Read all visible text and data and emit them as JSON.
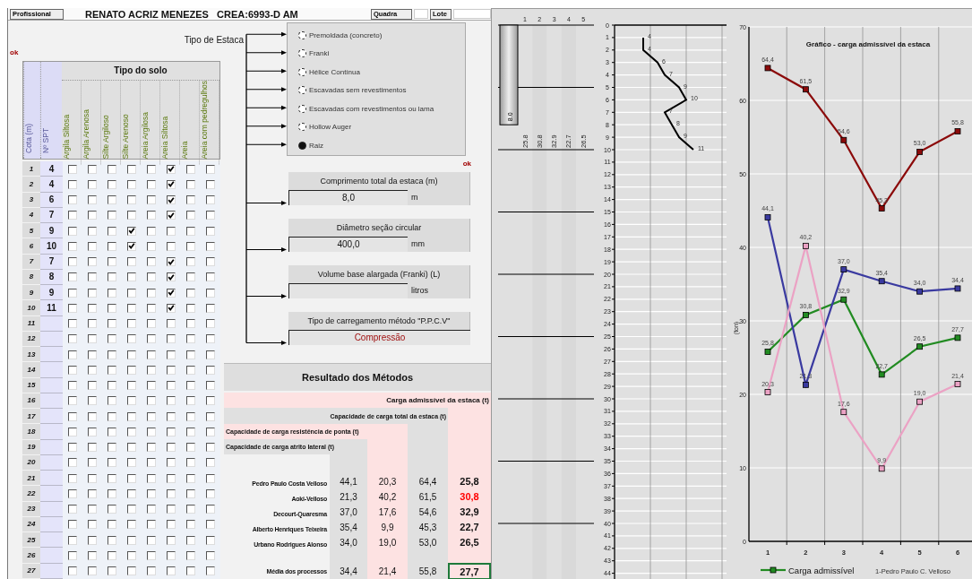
{
  "header": {
    "profissional_button": "Profissional",
    "title": "RENATO ACRIZ MENEZES   CREA:6993-D AM",
    "quadra_button": "Quadra",
    "lote_button": "Lote"
  },
  "soil_table": {
    "status": "ok",
    "cota_header": "Cota (m)",
    "spt_header": "Nº SPT",
    "group_header": "Tipo do solo",
    "soils": [
      "Argila Siltosa",
      "Argila Arenosa",
      "Silte Argiloso",
      "Silte Arenoso",
      "Areia Argilosa",
      "Areia Siltosa",
      "Areia",
      "Areia com pedregulhos"
    ],
    "rows": [
      {
        "cota": "1",
        "spt": "4",
        "soil": [
          false,
          false,
          false,
          false,
          false,
          true,
          false,
          false
        ]
      },
      {
        "cota": "2",
        "spt": "4",
        "soil": [
          false,
          false,
          false,
          false,
          false,
          true,
          false,
          false
        ]
      },
      {
        "cota": "3",
        "spt": "6",
        "soil": [
          false,
          false,
          false,
          false,
          false,
          true,
          false,
          false
        ]
      },
      {
        "cota": "4",
        "spt": "7",
        "soil": [
          false,
          false,
          false,
          false,
          false,
          true,
          false,
          false
        ]
      },
      {
        "cota": "5",
        "spt": "9",
        "soil": [
          false,
          false,
          false,
          true,
          false,
          false,
          false,
          false
        ]
      },
      {
        "cota": "6",
        "spt": "10",
        "soil": [
          false,
          false,
          false,
          true,
          false,
          false,
          false,
          false
        ]
      },
      {
        "cota": "7",
        "spt": "7",
        "soil": [
          false,
          false,
          false,
          false,
          false,
          true,
          false,
          false
        ]
      },
      {
        "cota": "8",
        "spt": "8",
        "soil": [
          false,
          false,
          false,
          false,
          false,
          true,
          false,
          false
        ]
      },
      {
        "cota": "9",
        "spt": "9",
        "soil": [
          false,
          false,
          false,
          false,
          false,
          true,
          false,
          false
        ]
      },
      {
        "cota": "10",
        "spt": "11",
        "soil": [
          false,
          false,
          false,
          false,
          false,
          true,
          false,
          false
        ]
      },
      {
        "cota": "11",
        "soil": [
          false,
          false,
          false,
          false,
          false,
          false,
          false,
          false
        ]
      },
      {
        "cota": "12",
        "soil": [
          false,
          false,
          false,
          false,
          false,
          false,
          false,
          false
        ]
      },
      {
        "cota": "13",
        "soil": [
          false,
          false,
          false,
          false,
          false,
          false,
          false,
          false
        ]
      },
      {
        "cota": "14",
        "soil": [
          false,
          false,
          false,
          false,
          false,
          false,
          false,
          false
        ]
      },
      {
        "cota": "15",
        "soil": [
          false,
          false,
          false,
          false,
          false,
          false,
          false,
          false
        ]
      },
      {
        "cota": "16",
        "soil": [
          false,
          false,
          false,
          false,
          false,
          false,
          false,
          false
        ]
      },
      {
        "cota": "17",
        "soil": [
          false,
          false,
          false,
          false,
          false,
          false,
          false,
          false
        ]
      },
      {
        "cota": "18",
        "soil": [
          false,
          false,
          false,
          false,
          false,
          false,
          false,
          false
        ]
      },
      {
        "cota": "19",
        "soil": [
          false,
          false,
          false,
          false,
          false,
          false,
          false,
          false
        ]
      },
      {
        "cota": "20",
        "soil": [
          false,
          false,
          false,
          false,
          false,
          false,
          false,
          false
        ]
      },
      {
        "cota": "21",
        "soil": [
          false,
          false,
          false,
          false,
          false,
          false,
          false,
          false
        ]
      },
      {
        "cota": "22",
        "soil": [
          false,
          false,
          false,
          false,
          false,
          false,
          false,
          false
        ]
      },
      {
        "cota": "23",
        "soil": [
          false,
          false,
          false,
          false,
          false,
          false,
          false,
          false
        ]
      },
      {
        "cota": "24",
        "soil": [
          false,
          false,
          false,
          false,
          false,
          false,
          false,
          false
        ]
      },
      {
        "cota": "25",
        "soil": [
          false,
          false,
          false,
          false,
          false,
          false,
          false,
          false
        ]
      },
      {
        "cota": "26",
        "soil": [
          false,
          false,
          false,
          false,
          false,
          false,
          false,
          false
        ]
      },
      {
        "cota": "27",
        "soil": [
          false,
          false,
          false,
          false,
          false,
          false,
          false,
          false
        ]
      }
    ]
  },
  "pile_type": {
    "label": "Tipo de Estaca",
    "options": [
      {
        "label": "Premoldada (concreto)",
        "selected": false
      },
      {
        "label": "Franki",
        "selected": false
      },
      {
        "label": "Hélice Contínua",
        "selected": false
      },
      {
        "label": "Escavadas sem revestimentos",
        "selected": false
      },
      {
        "label": "Escavadas com revestimentos ou lama",
        "selected": false
      },
      {
        "label": "Hollow Auger",
        "selected": false
      },
      {
        "label": "Raiz",
        "selected": true
      }
    ]
  },
  "parameters": {
    "status": "ok",
    "inputs": [
      {
        "kind": "measure",
        "title": "Comprimento total da estaca (m)",
        "value": "8,0",
        "unit": "m"
      },
      {
        "kind": "measure",
        "title": "Diâmetro seção circular",
        "value": "400,0",
        "unit": "mm"
      },
      {
        "kind": "measure",
        "title": "Volume base alargada (Franki) (L)",
        "unit": "litros"
      },
      {
        "kind": "choice",
        "title": "Tipo de carregamento método \"P.P.C.V\"",
        "value": "Compressão"
      }
    ]
  },
  "results": {
    "title": "Resultado dos Métodos",
    "headers": [
      "Carga admissível da estaca (t)",
      "Capacidade de carga total da estaca (t)",
      "Capacidade de carga resistência de ponta (t)",
      "Capacidade de carga atrito lateral (t)"
    ],
    "methods": [
      {
        "name": "Pedro Paulo Costa Velloso",
        "lateral": "44,1",
        "ponta": "20,3",
        "total": "64,4",
        "admissible": "25,8",
        "flagged": false
      },
      {
        "name": "Aoki-Velloso",
        "lateral": "21,3",
        "ponta": "40,2",
        "total": "61,5",
        "admissible": "30,8",
        "flagged": true
      },
      {
        "name": "Decourt-Quaresma",
        "lateral": "37,0",
        "ponta": "17,6",
        "total": "54,6",
        "admissible": "32,9",
        "flagged": false
      },
      {
        "name": "Alberto Henriques Teixeira",
        "lateral": "35,4",
        "ponta": "9,9",
        "total": "45,3",
        "admissible": "22,7",
        "flagged": false
      },
      {
        "name": "Urbano Rodrigues Alonso",
        "lateral": "34,0",
        "ponta": "19,0",
        "total": "53,0",
        "admissible": "26,5",
        "flagged": false
      }
    ],
    "average": {
      "name": "Média dos processos",
      "lateral": "34,4",
      "ponta": "21,4",
      "total": "55,8",
      "admissible": "27,7",
      "selected": true
    }
  },
  "pile_diagram": {
    "length": "8.0",
    "columns": [
      {
        "label": "1",
        "value": "25.8"
      },
      {
        "label": "2",
        "value": "30.8"
      },
      {
        "label": "3",
        "value": "32.9"
      },
      {
        "label": "4",
        "value": "22.7"
      },
      {
        "label": "5",
        "value": "26.5"
      }
    ]
  },
  "spt_profile": {
    "depth_labels": [
      "0",
      "1",
      "2",
      "3",
      "4",
      "5",
      "6",
      "7",
      "8",
      "9",
      "10",
      "11",
      "12",
      "13",
      "14",
      "15",
      "16",
      "17",
      "18",
      "19",
      "20",
      "21",
      "22",
      "23",
      "24",
      "25",
      "26",
      "27",
      "28",
      "29",
      "30",
      "31",
      "32",
      "33",
      "34",
      "35",
      "36",
      "37",
      "38",
      "39",
      "40",
      "41",
      "42",
      "43",
      "44"
    ],
    "point_labels": [
      "4",
      "4",
      "6",
      "7",
      "9",
      "10",
      "7",
      "8",
      "9",
      "11"
    ]
  },
  "load_chart": {
    "legend_note": "1-Pedro Paulo C. Velloso",
    "chart_data": {
      "type": "line",
      "title": "Gráfico - carga admissível da estaca",
      "ylabel": "(ton)",
      "categories": [
        "1",
        "2",
        "3",
        "4",
        "5",
        "6"
      ],
      "ylim": [
        0,
        70
      ],
      "yticks": [
        0,
        10,
        20,
        30,
        40,
        50,
        60,
        70
      ],
      "grid": true,
      "series": [
        {
          "name": "Carga admissível",
          "color": "#228b22",
          "marker": "square",
          "values": [
            25.8,
            30.8,
            32.9,
            22.7,
            26.5,
            27.7
          ],
          "value_labels": [
            "25,8",
            "30,8",
            "32,9",
            "22,7",
            "26,5",
            "27,7"
          ]
        },
        {
          "color": "#3a3aa0",
          "marker": "square",
          "values": [
            44.1,
            21.3,
            37.0,
            35.4,
            34.0,
            34.4
          ],
          "value_labels": [
            "44,1",
            "21,3",
            "37,0",
            "35,4",
            "34,0",
            "34,4"
          ]
        },
        {
          "color": "#eba2c4",
          "marker": "square",
          "values": [
            20.3,
            40.2,
            17.6,
            9.9,
            19.0,
            21.4
          ],
          "value_labels": [
            "20,3",
            "40,2",
            "17,6",
            "9,9",
            "19,0",
            "21,4"
          ]
        },
        {
          "color": "#8b0a0a",
          "marker": "square",
          "values": [
            64.4,
            61.5,
            54.6,
            45.3,
            53.0,
            55.8
          ],
          "value_labels": [
            "64,4",
            "61,5",
            "54,6",
            "45,3",
            "53,0",
            "55,8"
          ]
        }
      ]
    }
  }
}
